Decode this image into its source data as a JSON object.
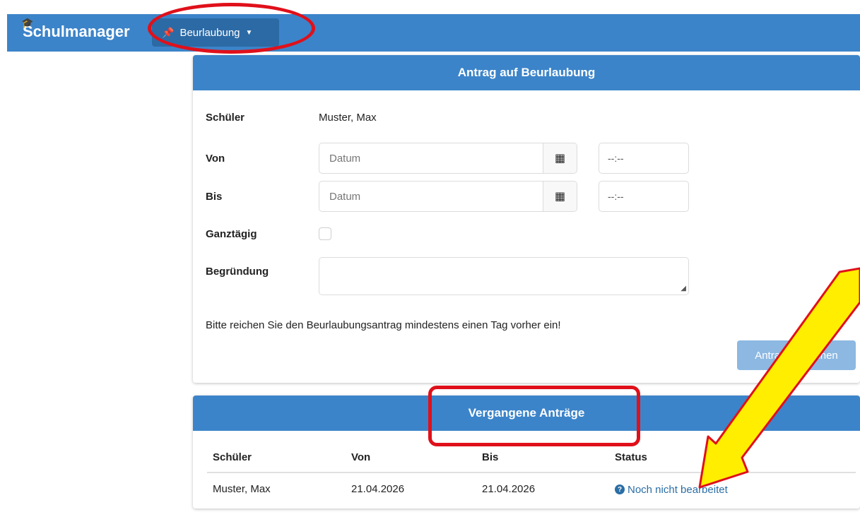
{
  "navbar": {
    "brand": "Schulmanager",
    "menu_label": "Beurlaubung"
  },
  "form": {
    "title": "Antrag auf Beurlaubung",
    "student_label": "Schüler",
    "student_value": "Muster, Max",
    "from_label": "Von",
    "from_placeholder": "Datum",
    "from_time": "--:--",
    "to_label": "Bis",
    "to_placeholder": "Datum",
    "to_time": "--:--",
    "allday_label": "Ganztägig",
    "reason_label": "Begründung",
    "hint": "Bitte reichen Sie den Beurlaubungsantrag mindestens einen Tag vorher ein!",
    "submit_label": "Antrag einreichen"
  },
  "past": {
    "title": "Vergangene Anträge",
    "columns": [
      "Schüler",
      "Von",
      "Bis",
      "Status"
    ],
    "rows": [
      [
        "Muster, Max",
        "21.04.2026",
        "21.04.2026",
        "Noch nicht bearbeitet"
      ]
    ]
  },
  "colors": {
    "primary": "#3c84c9",
    "highlight": "#e0101a",
    "arrow": "#ffee00"
  }
}
